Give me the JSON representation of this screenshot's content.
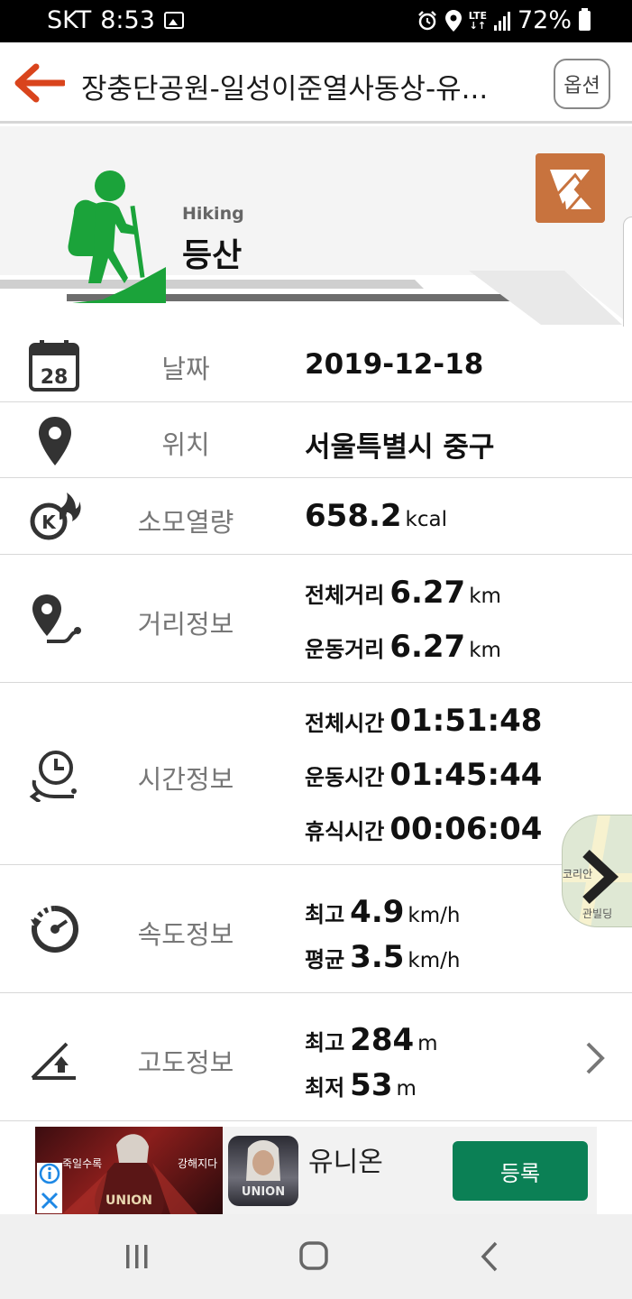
{
  "status_bar": {
    "carrier": "SKT",
    "time": "8:53",
    "network": "LTE",
    "battery": "72%"
  },
  "app_bar": {
    "title": "장충단공원-일성이준열사동상-유...",
    "options_label": "옵션"
  },
  "hero": {
    "activity_en": "Hiking",
    "activity_ko": "등산"
  },
  "rows": {
    "date": {
      "label": "날짜",
      "calendar_day": "28",
      "value": "2019-12-18"
    },
    "location": {
      "label": "위치",
      "value": "서울특별시 중구"
    },
    "calories": {
      "label": "소모열량",
      "value": "658.2",
      "unit": "kcal",
      "icon_letter": "K"
    },
    "distance": {
      "label": "거리정보",
      "items": [
        {
          "key": "전체거리",
          "value": "6.27",
          "unit": "km"
        },
        {
          "key": "운동거리",
          "value": "6.27",
          "unit": "km"
        }
      ]
    },
    "time": {
      "label": "시간정보",
      "items": [
        {
          "key": "전체시간",
          "value": "01:51:48"
        },
        {
          "key": "운동시간",
          "value": "01:45:44"
        },
        {
          "key": "휴식시간",
          "value": "00:06:04"
        }
      ]
    },
    "speed": {
      "label": "속도정보",
      "items": [
        {
          "key": "최고",
          "value": "4.9",
          "unit": "km/h"
        },
        {
          "key": "평균",
          "value": "3.5",
          "unit": "km/h"
        }
      ]
    },
    "altitude": {
      "label": "고도정보",
      "items": [
        {
          "key": "최고",
          "value": "284",
          "unit": "m"
        },
        {
          "key": "최저",
          "value": "53",
          "unit": "m"
        }
      ]
    }
  },
  "ad": {
    "banner_text_left": "죽일수록",
    "banner_text_right": "강해지다",
    "banner_logo": "UNION",
    "app_logo": "UNION",
    "app_name": "유니온",
    "cta": "등록"
  },
  "map_fab": {
    "text_top": "코리안",
    "text_bottom": "관빌딩"
  },
  "colors": {
    "accent_orange": "#d9441c",
    "hiker_green": "#1ba33a",
    "share_orange": "#c8733e",
    "ad_button_green": "#0b8055"
  },
  "icons": {
    "back": "arrow-left-icon",
    "share": "share-icon",
    "calendar": "calendar-icon",
    "location": "location-pin-icon",
    "calories": "calorie-flame-icon",
    "distance": "route-pin-icon",
    "time": "clock-icon",
    "speed": "speedometer-icon",
    "altitude": "elevation-icon",
    "chevron": "chevron-right-icon"
  }
}
